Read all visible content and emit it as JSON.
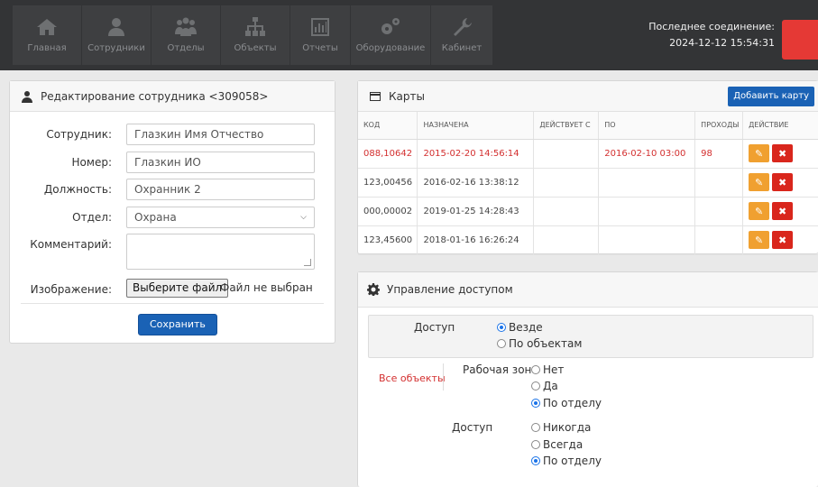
{
  "nav": [
    {
      "label": "Главная",
      "icon": "home-icon"
    },
    {
      "label": "Сотрудники",
      "icon": "user-icon"
    },
    {
      "label": "Отделы",
      "icon": "group-icon"
    },
    {
      "label": "Объекты",
      "icon": "sitemap-icon"
    },
    {
      "label": "Отчеты",
      "icon": "chart-icon"
    },
    {
      "label": "Оборудование",
      "icon": "gears-icon"
    },
    {
      "label": "Кабинет",
      "icon": "wrench-icon"
    }
  ],
  "connection": {
    "label": "Последнее соединение:",
    "datetime": "2024-12-12 15:54:31"
  },
  "employee_panel": {
    "title": "Редактирование сотрудника <309058>",
    "fields": {
      "employee": {
        "label": "Сотрудник:",
        "value": "Глазкин Имя Отчество"
      },
      "number": {
        "label": "Номер:",
        "value": "Глазкин ИО"
      },
      "position": {
        "label": "Должность:",
        "value": "Охранник 2"
      },
      "department": {
        "label": "Отдел:",
        "value": "Охрана"
      },
      "comment": {
        "label": "Комментарий:",
        "value": ""
      },
      "image": {
        "label": "Изображение:",
        "button": "Выберите файл",
        "status": "Файл не выбран"
      }
    },
    "save_label": "Сохранить"
  },
  "cards_panel": {
    "title": "Карты",
    "add_label": "Добавить карту",
    "columns": [
      "КОД",
      "НАЗНАЧЕНА",
      "ДЕЙСТВУЕТ С",
      "ПО",
      "ПРОХОДЫ",
      "ДЕЙСТВИЕ"
    ],
    "rows": [
      {
        "code": "088,10642",
        "assigned": "2015-02-20 14:56:14",
        "valid_from": "",
        "valid_to": "2016-02-10 03:00",
        "passes": "98",
        "expired": true
      },
      {
        "code": "123,00456",
        "assigned": "2016-02-16 13:38:12",
        "valid_from": "",
        "valid_to": "",
        "passes": "",
        "expired": false
      },
      {
        "code": "000,00002",
        "assigned": "2019-01-25 14:28:43",
        "valid_from": "",
        "valid_to": "",
        "passes": "",
        "expired": false
      },
      {
        "code": "123,45600",
        "assigned": "2018-01-16 16:26:24",
        "valid_from": "",
        "valid_to": "",
        "passes": "",
        "expired": false
      }
    ],
    "colors": {
      "expired": "#d32f2f",
      "edit": "#f0a030",
      "delete": "#d9261c"
    }
  },
  "access_panel": {
    "title": "Управление доступом",
    "access_label": "Доступ",
    "access_options": {
      "everywhere": "Везде",
      "by_objects": "По объектам",
      "selected": "everywhere"
    },
    "all_objects": "Все объекты",
    "work_zone": {
      "label": "Рабочая зона",
      "options": [
        "Нет",
        "Да",
        "По отделу"
      ],
      "selected": "По отделу"
    },
    "access2": {
      "label": "Доступ",
      "options": [
        "Никогда",
        "Всегда",
        "По отделу"
      ],
      "selected": "По отделу"
    }
  }
}
